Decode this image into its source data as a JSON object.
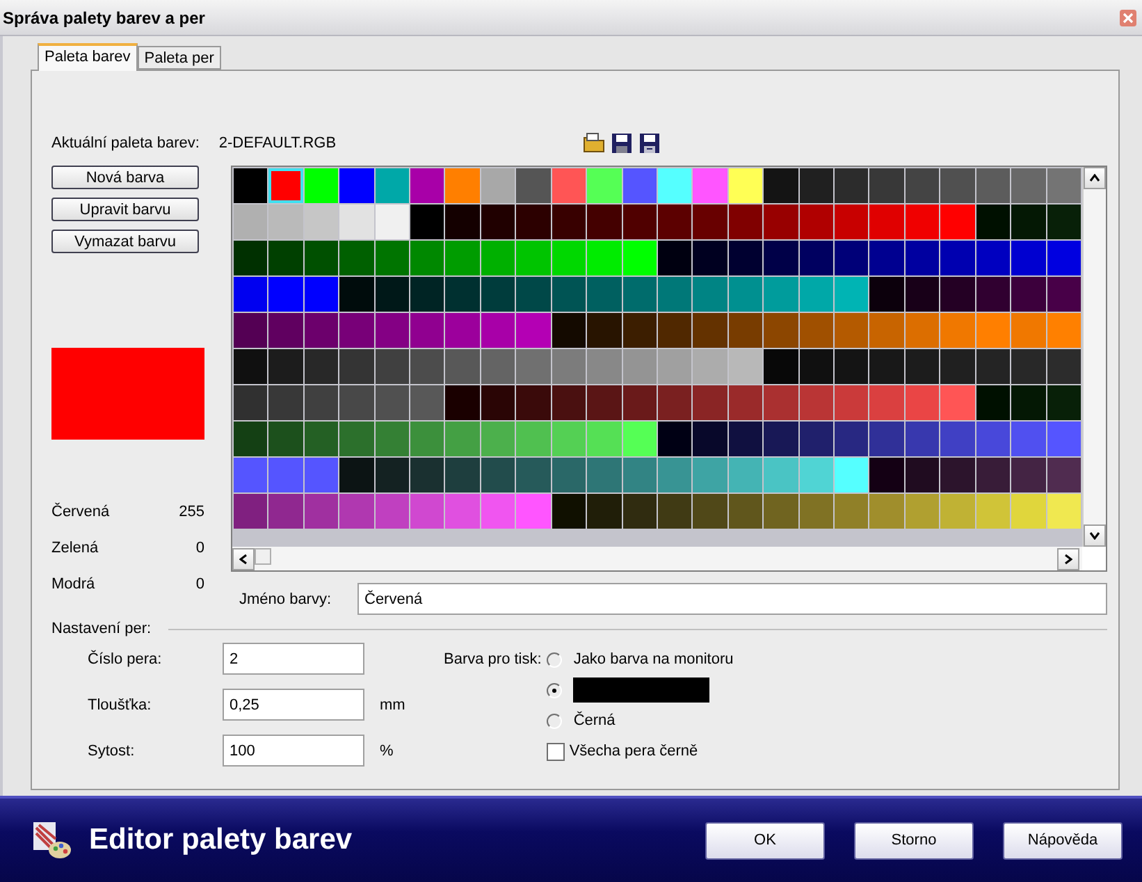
{
  "window": {
    "title": "Správa palety barev a per"
  },
  "tabs": [
    {
      "label": "Paleta barev",
      "selected": true
    },
    {
      "label": "Paleta per",
      "selected": false
    }
  ],
  "palette_label": "Aktuální paleta barev:",
  "palette_file": "2-DEFAULT.RGB",
  "color_buttons": [
    "Nová barva",
    "Upravit barvu",
    "Vymazat barvu"
  ],
  "preview": {
    "color": "#ff0000"
  },
  "components": [
    {
      "label": "Červená",
      "value": "255"
    },
    {
      "label": "Zelená",
      "value": "0"
    },
    {
      "label": "Modrá",
      "value": "0"
    }
  ],
  "palette": [
    {
      "swatches": [
        {
          "color": "#000000",
          "selected": false
        },
        {
          "color": "#ff0000",
          "selected": true
        },
        {
          "color": "#00ff00",
          "selected": false
        },
        {
          "color": "#0000ff",
          "selected": false
        },
        {
          "color": "#00a8a8",
          "selected": false
        },
        {
          "color": "#a800a8",
          "selected": false
        },
        {
          "color": "#ff7f00",
          "selected": false
        },
        {
          "color": "#a8a8a8",
          "selected": false
        },
        {
          "color": "#555555",
          "selected": false
        },
        {
          "color": "#ff5555",
          "selected": false
        },
        {
          "color": "#55ff55",
          "selected": false
        },
        {
          "color": "#5555ff",
          "selected": false
        },
        {
          "color": "#55ffff",
          "selected": false
        },
        {
          "color": "#ff55ff",
          "selected": false
        },
        {
          "color": "#ffff55",
          "selected": false
        },
        {
          "color": "#141414",
          "selected": false
        },
        {
          "color": "#202020",
          "selected": false
        },
        {
          "color": "#2c2c2c",
          "selected": false
        },
        {
          "color": "#383838",
          "selected": false
        },
        {
          "color": "#444444",
          "selected": false
        },
        {
          "color": "#505050",
          "selected": false
        },
        {
          "color": "#5c5c5c",
          "selected": false
        },
        {
          "color": "#686868",
          "selected": false
        },
        {
          "color": "#747474",
          "selected": false
        }
      ]
    },
    {
      "swatches": [
        {
          "color": "#b0b0b0",
          "selected": false
        },
        {
          "color": "#bababa",
          "selected": false
        },
        {
          "color": "#c6c6c6",
          "selected": false
        },
        {
          "color": "#e2e2e2",
          "selected": false
        },
        {
          "color": "#f0f0f0",
          "selected": false
        },
        {
          "color": "#000000",
          "selected": false
        },
        {
          "color": "#140000",
          "selected": false
        },
        {
          "color": "#200000",
          "selected": false
        },
        {
          "color": "#2c0000",
          "selected": false
        },
        {
          "color": "#380000",
          "selected": false
        },
        {
          "color": "#440000",
          "selected": false
        },
        {
          "color": "#500000",
          "selected": false
        },
        {
          "color": "#5c0000",
          "selected": false
        },
        {
          "color": "#680000",
          "selected": false
        },
        {
          "color": "#800000",
          "selected": false
        },
        {
          "color": "#980000",
          "selected": false
        },
        {
          "color": "#b00000",
          "selected": false
        },
        {
          "color": "#c80000",
          "selected": false
        },
        {
          "color": "#e00000",
          "selected": false
        },
        {
          "color": "#f00000",
          "selected": false
        },
        {
          "color": "#ff0000",
          "selected": false
        },
        {
          "color": "#001000",
          "selected": false
        },
        {
          "color": "#041804",
          "selected": false
        },
        {
          "color": "#082008",
          "selected": false
        }
      ]
    },
    {
      "swatches": [
        {
          "color": "#003000",
          "selected": false
        },
        {
          "color": "#004000",
          "selected": false
        },
        {
          "color": "#005000",
          "selected": false
        },
        {
          "color": "#006000",
          "selected": false
        },
        {
          "color": "#007400",
          "selected": false
        },
        {
          "color": "#008800",
          "selected": false
        },
        {
          "color": "#009c00",
          "selected": false
        },
        {
          "color": "#00b000",
          "selected": false
        },
        {
          "color": "#00c400",
          "selected": false
        },
        {
          "color": "#00d800",
          "selected": false
        },
        {
          "color": "#00ec00",
          "selected": false
        },
        {
          "color": "#00ff00",
          "selected": false
        },
        {
          "color": "#000010",
          "selected": false
        },
        {
          "color": "#000020",
          "selected": false
        },
        {
          "color": "#000030",
          "selected": false
        },
        {
          "color": "#000048",
          "selected": false
        },
        {
          "color": "#000060",
          "selected": false
        },
        {
          "color": "#000078",
          "selected": false
        },
        {
          "color": "#000090",
          "selected": false
        },
        {
          "color": "#0000a0",
          "selected": false
        },
        {
          "color": "#0000b0",
          "selected": false
        },
        {
          "color": "#0000c0",
          "selected": false
        },
        {
          "color": "#0000d0",
          "selected": false
        },
        {
          "color": "#0000e0",
          "selected": false
        }
      ]
    },
    {
      "swatches": [
        {
          "color": "#0000f0",
          "selected": false
        },
        {
          "color": "#0000ff",
          "selected": false
        },
        {
          "color": "#0000ff",
          "selected": false
        },
        {
          "color": "#000c0c",
          "selected": false
        },
        {
          "color": "#001818",
          "selected": false
        },
        {
          "color": "#002424",
          "selected": false
        },
        {
          "color": "#003030",
          "selected": false
        },
        {
          "color": "#003c3c",
          "selected": false
        },
        {
          "color": "#004848",
          "selected": false
        },
        {
          "color": "#005454",
          "selected": false
        },
        {
          "color": "#006060",
          "selected": false
        },
        {
          "color": "#006c6c",
          "selected": false
        },
        {
          "color": "#007878",
          "selected": false
        },
        {
          "color": "#008484",
          "selected": false
        },
        {
          "color": "#009090",
          "selected": false
        },
        {
          "color": "#009c9c",
          "selected": false
        },
        {
          "color": "#00a8a8",
          "selected": false
        },
        {
          "color": "#00b4b4",
          "selected": false
        },
        {
          "color": "#0c000c",
          "selected": false
        },
        {
          "color": "#180018",
          "selected": false
        },
        {
          "color": "#240024",
          "selected": false
        },
        {
          "color": "#300030",
          "selected": false
        },
        {
          "color": "#3c003c",
          "selected": false
        },
        {
          "color": "#480048",
          "selected": false
        }
      ]
    },
    {
      "swatches": [
        {
          "color": "#540054",
          "selected": false
        },
        {
          "color": "#600060",
          "selected": false
        },
        {
          "color": "#6c006c",
          "selected": false
        },
        {
          "color": "#780078",
          "selected": false
        },
        {
          "color": "#840084",
          "selected": false
        },
        {
          "color": "#900090",
          "selected": false
        },
        {
          "color": "#9c009c",
          "selected": false
        },
        {
          "color": "#a800a8",
          "selected": false
        },
        {
          "color": "#b400b4",
          "selected": false
        },
        {
          "color": "#140a00",
          "selected": false
        },
        {
          "color": "#281400",
          "selected": false
        },
        {
          "color": "#3c1e00",
          "selected": false
        },
        {
          "color": "#502800",
          "selected": false
        },
        {
          "color": "#643200",
          "selected": false
        },
        {
          "color": "#783c00",
          "selected": false
        },
        {
          "color": "#8c4600",
          "selected": false
        },
        {
          "color": "#a05000",
          "selected": false
        },
        {
          "color": "#b45a00",
          "selected": false
        },
        {
          "color": "#c86400",
          "selected": false
        },
        {
          "color": "#dc6e00",
          "selected": false
        },
        {
          "color": "#f07800",
          "selected": false
        },
        {
          "color": "#ff7f00",
          "selected": false
        },
        {
          "color": "#f07800",
          "selected": false
        },
        {
          "color": "#ff8000",
          "selected": false
        }
      ]
    },
    {
      "swatches": [
        {
          "color": "#101010",
          "selected": false
        },
        {
          "color": "#1c1c1c",
          "selected": false
        },
        {
          "color": "#282828",
          "selected": false
        },
        {
          "color": "#343434",
          "selected": false
        },
        {
          "color": "#404040",
          "selected": false
        },
        {
          "color": "#4c4c4c",
          "selected": false
        },
        {
          "color": "#585858",
          "selected": false
        },
        {
          "color": "#646464",
          "selected": false
        },
        {
          "color": "#707070",
          "selected": false
        },
        {
          "color": "#7c7c7c",
          "selected": false
        },
        {
          "color": "#888888",
          "selected": false
        },
        {
          "color": "#949494",
          "selected": false
        },
        {
          "color": "#a0a0a0",
          "selected": false
        },
        {
          "color": "#acacac",
          "selected": false
        },
        {
          "color": "#b8b8b8",
          "selected": false
        },
        {
          "color": "#080808",
          "selected": false
        },
        {
          "color": "#101010",
          "selected": false
        },
        {
          "color": "#141414",
          "selected": false
        },
        {
          "color": "#181818",
          "selected": false
        },
        {
          "color": "#1c1c1c",
          "selected": false
        },
        {
          "color": "#202020",
          "selected": false
        },
        {
          "color": "#242424",
          "selected": false
        },
        {
          "color": "#282828",
          "selected": false
        },
        {
          "color": "#2c2c2c",
          "selected": false
        }
      ]
    },
    {
      "swatches": [
        {
          "color": "#303030",
          "selected": false
        },
        {
          "color": "#383838",
          "selected": false
        },
        {
          "color": "#404040",
          "selected": false
        },
        {
          "color": "#484848",
          "selected": false
        },
        {
          "color": "#505050",
          "selected": false
        },
        {
          "color": "#585858",
          "selected": false
        },
        {
          "color": "#1a0000",
          "selected": false
        },
        {
          "color": "#2a0505",
          "selected": false
        },
        {
          "color": "#3a0a0a",
          "selected": false
        },
        {
          "color": "#4a1010",
          "selected": false
        },
        {
          "color": "#5a1515",
          "selected": false
        },
        {
          "color": "#6a1a1a",
          "selected": false
        },
        {
          "color": "#7a2020",
          "selected": false
        },
        {
          "color": "#8a2525",
          "selected": false
        },
        {
          "color": "#9a2a2a",
          "selected": false
        },
        {
          "color": "#aa3030",
          "selected": false
        },
        {
          "color": "#ba3535",
          "selected": false
        },
        {
          "color": "#ca3a3a",
          "selected": false
        },
        {
          "color": "#da4040",
          "selected": false
        },
        {
          "color": "#ea4545",
          "selected": false
        },
        {
          "color": "#ff5555",
          "selected": false
        },
        {
          "color": "#001000",
          "selected": false
        },
        {
          "color": "#041804",
          "selected": false
        },
        {
          "color": "#082008",
          "selected": false
        }
      ]
    },
    {
      "swatches": [
        {
          "color": "#144014",
          "selected": false
        },
        {
          "color": "#1c501c",
          "selected": false
        },
        {
          "color": "#246024",
          "selected": false
        },
        {
          "color": "#2c702c",
          "selected": false
        },
        {
          "color": "#348034",
          "selected": false
        },
        {
          "color": "#3c903c",
          "selected": false
        },
        {
          "color": "#44a044",
          "selected": false
        },
        {
          "color": "#4cb04c",
          "selected": false
        },
        {
          "color": "#50c050",
          "selected": false
        },
        {
          "color": "#54d054",
          "selected": false
        },
        {
          "color": "#55e055",
          "selected": false
        },
        {
          "color": "#55ff55",
          "selected": false
        },
        {
          "color": "#000014",
          "selected": false
        },
        {
          "color": "#08082a",
          "selected": false
        },
        {
          "color": "#101040",
          "selected": false
        },
        {
          "color": "#181856",
          "selected": false
        },
        {
          "color": "#20206c",
          "selected": false
        },
        {
          "color": "#282882",
          "selected": false
        },
        {
          "color": "#303098",
          "selected": false
        },
        {
          "color": "#3838ae",
          "selected": false
        },
        {
          "color": "#4040c4",
          "selected": false
        },
        {
          "color": "#4848da",
          "selected": false
        },
        {
          "color": "#5050f0",
          "selected": false
        },
        {
          "color": "#5555ff",
          "selected": false
        }
      ]
    },
    {
      "swatches": [
        {
          "color": "#5555ff",
          "selected": false
        },
        {
          "color": "#5555ff",
          "selected": false
        },
        {
          "color": "#5555ff",
          "selected": false
        },
        {
          "color": "#0c1414",
          "selected": false
        },
        {
          "color": "#142222",
          "selected": false
        },
        {
          "color": "#1a3030",
          "selected": false
        },
        {
          "color": "#1e3e3e",
          "selected": false
        },
        {
          "color": "#224c4c",
          "selected": false
        },
        {
          "color": "#265a5a",
          "selected": false
        },
        {
          "color": "#2a6868",
          "selected": false
        },
        {
          "color": "#2e7676",
          "selected": false
        },
        {
          "color": "#328484",
          "selected": false
        },
        {
          "color": "#389494",
          "selected": false
        },
        {
          "color": "#3ea4a4",
          "selected": false
        },
        {
          "color": "#44b4b4",
          "selected": false
        },
        {
          "color": "#4ac4c4",
          "selected": false
        },
        {
          "color": "#50d4d4",
          "selected": false
        },
        {
          "color": "#55ffff",
          "selected": false
        },
        {
          "color": "#140014",
          "selected": false
        },
        {
          "color": "#200c20",
          "selected": false
        },
        {
          "color": "#2c142c",
          "selected": false
        },
        {
          "color": "#381c38",
          "selected": false
        },
        {
          "color": "#442444",
          "selected": false
        },
        {
          "color": "#502c50",
          "selected": false
        }
      ]
    },
    {
      "swatches": [
        {
          "color": "#802080",
          "selected": false
        },
        {
          "color": "#902890",
          "selected": false
        },
        {
          "color": "#a030a0",
          "selected": false
        },
        {
          "color": "#b038b0",
          "selected": false
        },
        {
          "color": "#c040c0",
          "selected": false
        },
        {
          "color": "#d048d0",
          "selected": false
        },
        {
          "color": "#e050e0",
          "selected": false
        },
        {
          "color": "#f055f0",
          "selected": false
        },
        {
          "color": "#ff55ff",
          "selected": false
        },
        {
          "color": "#101000",
          "selected": false
        },
        {
          "color": "#201e08",
          "selected": false
        },
        {
          "color": "#302c10",
          "selected": false
        },
        {
          "color": "#403a14",
          "selected": false
        },
        {
          "color": "#504818",
          "selected": false
        },
        {
          "color": "#60561c",
          "selected": false
        },
        {
          "color": "#706420",
          "selected": false
        },
        {
          "color": "#807224",
          "selected": false
        },
        {
          "color": "#908028",
          "selected": false
        },
        {
          "color": "#a08e2c",
          "selected": false
        },
        {
          "color": "#b0a030",
          "selected": false
        },
        {
          "color": "#c0b234",
          "selected": false
        },
        {
          "color": "#d0c438",
          "selected": false
        },
        {
          "color": "#e0d63c",
          "selected": false
        },
        {
          "color": "#f0e850",
          "selected": false
        }
      ]
    }
  ],
  "color_name": {
    "label": "Jméno barvy:",
    "value": "Červená"
  },
  "pen_section": "Nastavení per:",
  "pen_fields": [
    {
      "label": "Číslo pera:",
      "value": "2"
    },
    {
      "label": "Tloušťka:",
      "value": "0,25",
      "unit": "mm"
    },
    {
      "label": "Sytost:",
      "value": "100",
      "unit": "%"
    }
  ],
  "print_color": {
    "label": "Barva pro tisk:",
    "options": [
      {
        "kind": "text",
        "label": "Jako barva na monitoru",
        "selected": false
      },
      {
        "kind": "swatch",
        "color": "#000000",
        "selected": true
      },
      {
        "kind": "text",
        "label": "Černá",
        "selected": false
      }
    ],
    "all_black": {
      "label": "Všecha pera černě",
      "checked": false
    }
  },
  "banner": {
    "title": "Editor palety barev"
  },
  "buttons": [
    "OK",
    "Storno",
    "Nápověda"
  ]
}
